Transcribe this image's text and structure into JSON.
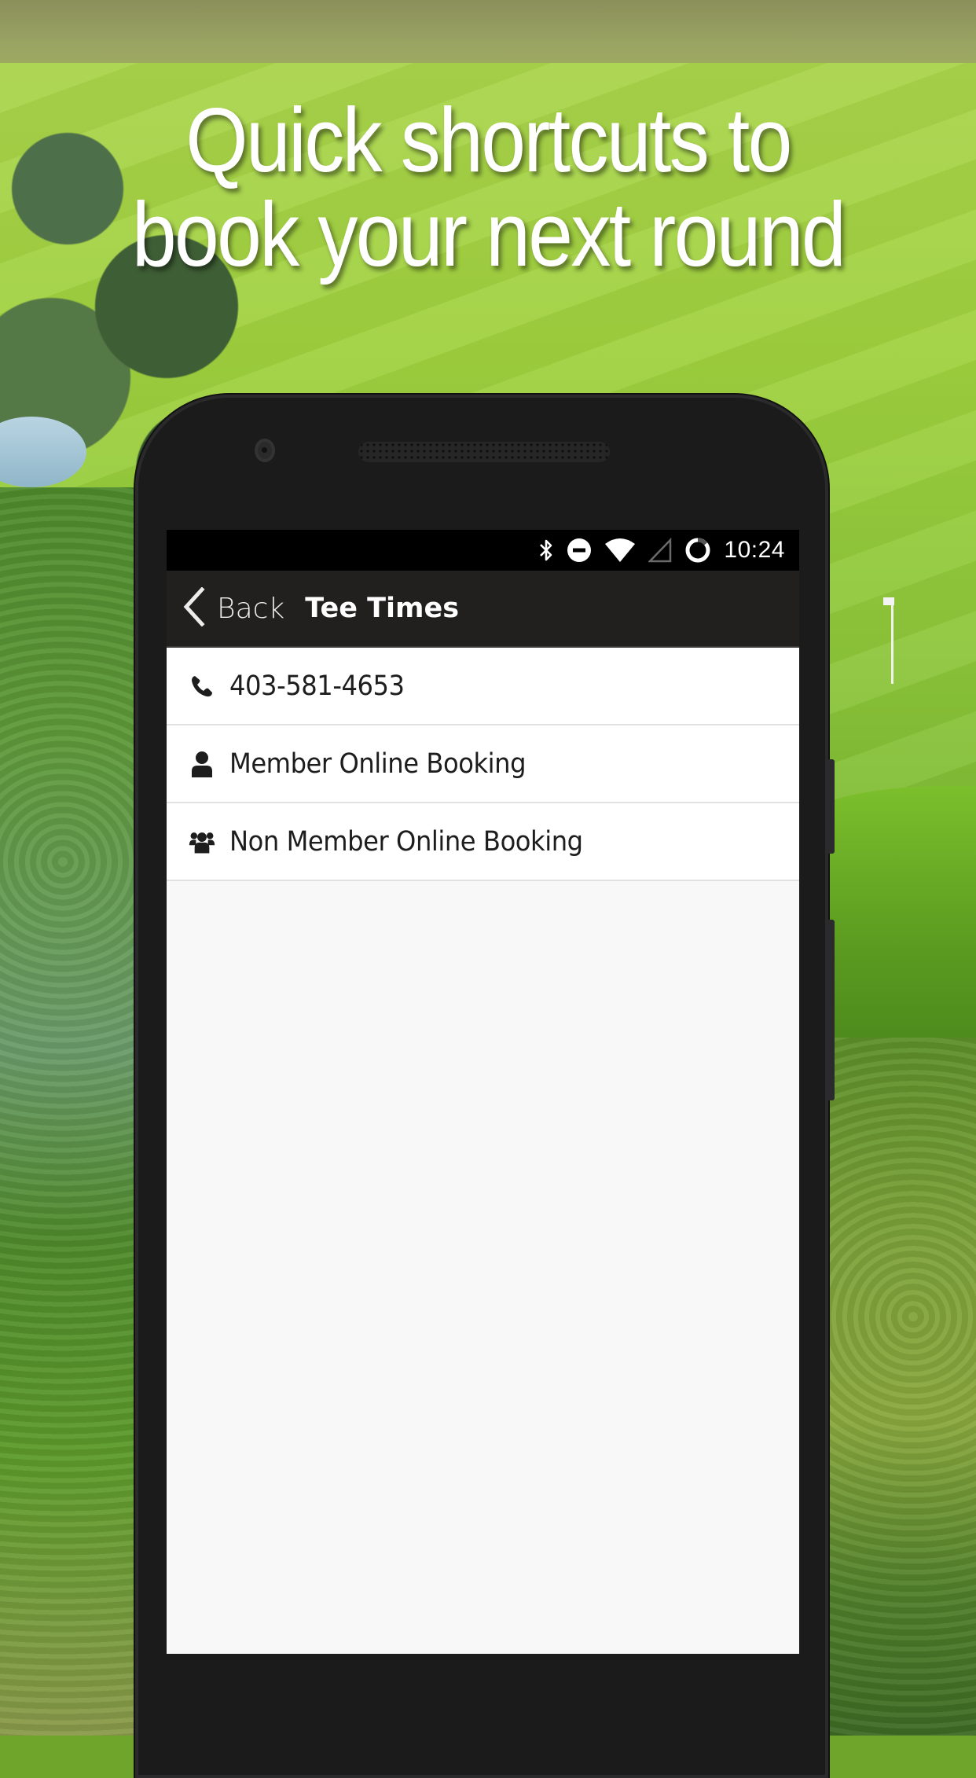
{
  "promo": {
    "headline_line1": "Quick shortcuts to",
    "headline_line2": "book your next round"
  },
  "status_bar": {
    "icons": [
      "bluetooth-icon",
      "do-not-disturb-icon",
      "wifi-icon",
      "cell-signal-icon",
      "battery-icon"
    ],
    "time": "10:24"
  },
  "app_bar": {
    "back_label": "Back",
    "title": "Tee Times"
  },
  "menu": {
    "items": [
      {
        "icon": "phone-icon",
        "label": "403-581-4653"
      },
      {
        "icon": "user-icon",
        "label": "Member Online Booking"
      },
      {
        "icon": "users-icon",
        "label": "Non Member Online Booking"
      }
    ]
  },
  "colors": {
    "status_bar_bg": "#000000",
    "app_bar_bg": "#221f1f",
    "list_bg": "#ffffff",
    "screen_bg": "#f8f8f8",
    "phone_body": "#1b1b1c",
    "divider": "#e2e2e2"
  }
}
